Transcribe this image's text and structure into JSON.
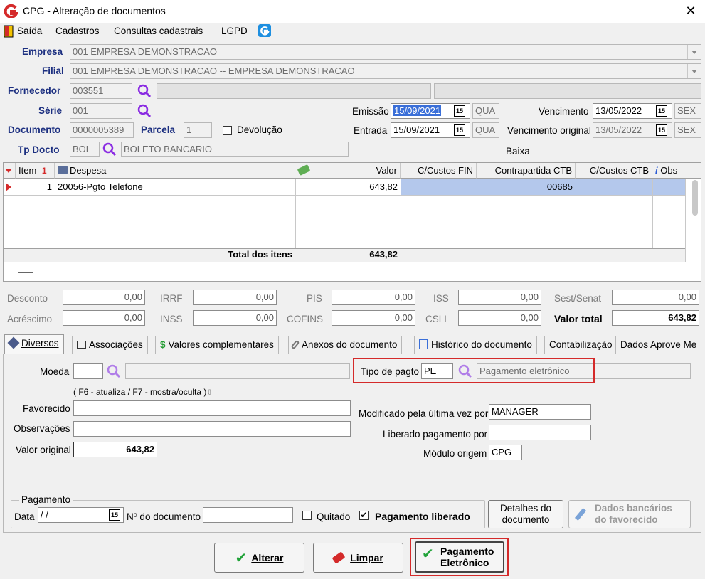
{
  "window": {
    "title": "CPG - Alteração de documentos",
    "close": "✕"
  },
  "menu": {
    "items": [
      "Saída",
      "Cadastros",
      "Consultas cadastrais",
      "LGPD"
    ]
  },
  "header": {
    "empresa_label": "Empresa",
    "empresa_value": "001 EMPRESA DEMONSTRACAO",
    "filial_label": "Filial",
    "filial_value": "001 EMPRESA DEMONSTRACAO -- EMPRESA DEMONSTRACAO",
    "fornecedor_label": "Fornecedor",
    "fornecedor_value": "003551",
    "serie_label": "Série",
    "serie_value": "001",
    "documento_label": "Documento",
    "documento_value": "0000005389",
    "parcela_label": "Parcela",
    "parcela_value": "1",
    "devolucao_label": "Devolução",
    "tpdocto_label": "Tp Docto",
    "tpdocto_code": "BOL",
    "tpdocto_desc": "BOLETO BANCARIO",
    "emissao_label": "Emissão",
    "emissao_value": "15/09/2021",
    "emissao_day": "QUA",
    "entrada_label": "Entrada",
    "entrada_value": "15/09/2021",
    "entrada_day": "QUA",
    "vencimento_label": "Vencimento",
    "vencimento_value": "13/05/2022",
    "vencimento_day": "SEX",
    "venc_original_label": "Vencimento original",
    "venc_original_value": "13/05/2022",
    "venc_original_day": "SEX",
    "baixa_label": "Baixa",
    "cal_glyph": "15"
  },
  "grid": {
    "columns": {
      "item": "Item",
      "item_sort": "1",
      "despesa": "Despesa",
      "valor": "Valor",
      "ccfin": "C/Custos FIN",
      "contra": "Contrapartida CTB",
      "ccctb": "C/Custos CTB",
      "obs": "Obs"
    },
    "row": {
      "item": "1",
      "despesa": "20056-Pgto Telefone",
      "valor": "643,82",
      "contra": "00685"
    },
    "total_label": "Total dos itens",
    "total_value": "643,82"
  },
  "totals": {
    "desconto_label": "Desconto",
    "desconto": "0,00",
    "irrf_label": "IRRF",
    "irrf": "0,00",
    "pis_label": "PIS",
    "pis": "0,00",
    "iss_label": "ISS",
    "iss": "0,00",
    "sest_label": "Sest/Senat",
    "sest": "0,00",
    "acrescimo_label": "Acréscimo",
    "acrescimo": "0,00",
    "inss_label": "INSS",
    "inss": "0,00",
    "cofins_label": "COFINS",
    "cofins": "0,00",
    "csll_label": "CSLL",
    "csll": "0,00",
    "valor_total_label": "Valor total",
    "valor_total": "643,82"
  },
  "tabs": [
    "Diversos",
    "Associações",
    "Valores complementares",
    "Anexos do documento",
    "Histórico do documento",
    "Contabilização",
    "Dados Aprove Me"
  ],
  "diversos": {
    "moeda_label": "Moeda",
    "hint": "( F6 - atualiza / F7 - mostra/oculta )",
    "favorecido_label": "Favorecido",
    "observacoes_label": "Observações",
    "valor_original_label": "Valor original",
    "valor_original": "643,82",
    "tipo_pagto_label": "Tipo de pagto",
    "tipo_pagto_code": "PE",
    "tipo_pagto_desc": "Pagamento eletrônico",
    "modificado_label": "Modificado pela última vez por",
    "modificado_value": "MANAGER",
    "liberado_label": "Liberado pagamento por",
    "modulo_label": "Módulo origem",
    "modulo_value": "CPG",
    "pagamento_group": "Pagamento",
    "data_label": "Data",
    "data_value": " / /",
    "ndoc_label": "Nº do documento",
    "quitado_label": "Quitado",
    "pag_liberado_label": "Pagamento liberado",
    "detalhes_btn": [
      "Detalhes do",
      "documento"
    ],
    "dados_btn": [
      "Dados bancários",
      "do favorecido"
    ]
  },
  "actions": {
    "alterar": "Alterar",
    "limpar": "Limpar",
    "pag_eletronico": [
      "Pagamento",
      "Eletrônico"
    ]
  },
  "colors": {
    "label_blue": "#1c2f80",
    "highlight": "#b4c8ec",
    "magnifier": "#8a2be2",
    "accent_red": "#d42a2a",
    "check_green": "#22a33a"
  }
}
